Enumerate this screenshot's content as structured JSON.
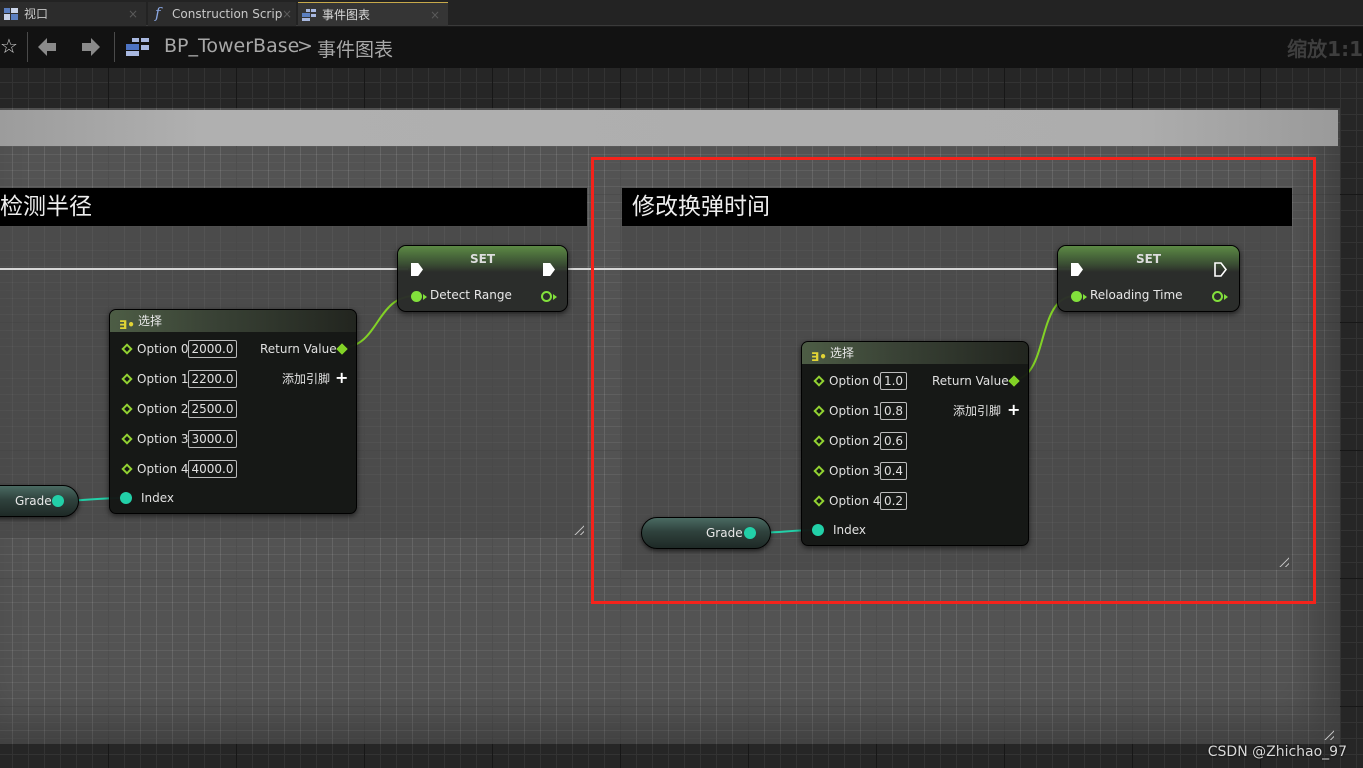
{
  "tabs": [
    {
      "label": "视口",
      "icon": "viewport-icon",
      "close": "×"
    },
    {
      "label": "Construction Scrip",
      "icon": "function-icon",
      "close": "×"
    },
    {
      "label": "事件图表",
      "icon": "event-graph-icon",
      "close": "×",
      "active": true
    }
  ],
  "toolbar": {
    "favorite_icon": "☆",
    "back_icon": "🡄",
    "forward_icon": "🡆",
    "breadcrumb": [
      "BP_TowerBase",
      "事件图表"
    ],
    "breadcrumb_separator": ">",
    "zoom_label": "缩放1:1"
  },
  "comments": {
    "left": {
      "title": "检测半径"
    },
    "right": {
      "title": "修改换弹时间"
    }
  },
  "left_group": {
    "select_node": {
      "title": "选择",
      "options": [
        {
          "label": "Option 0",
          "value": "2000.0"
        },
        {
          "label": "Option 1",
          "value": "2200.0"
        },
        {
          "label": "Option 2",
          "value": "2500.0"
        },
        {
          "label": "Option 3",
          "value": "3000.0"
        },
        {
          "label": "Option 4",
          "value": "4000.0"
        }
      ],
      "return_label": "Return Value",
      "add_pin_label": "添加引脚",
      "add_pin_icon": "+",
      "index_label": "Index"
    },
    "set_node": {
      "title": "SET",
      "variable": "Detect Range"
    },
    "get_node": {
      "label": "Grade"
    }
  },
  "right_group": {
    "select_node": {
      "title": "选择",
      "options": [
        {
          "label": "Option 0",
          "value": "1.0"
        },
        {
          "label": "Option 1",
          "value": "0.8"
        },
        {
          "label": "Option 2",
          "value": "0.6"
        },
        {
          "label": "Option 3",
          "value": "0.4"
        },
        {
          "label": "Option 4",
          "value": "0.2"
        }
      ],
      "return_label": "Return Value",
      "add_pin_label": "添加引脚",
      "add_pin_icon": "+",
      "index_label": "Index"
    },
    "set_node": {
      "title": "SET",
      "variable": "Reloading Time"
    },
    "get_node": {
      "label": "Grade"
    }
  },
  "colors": {
    "highlight_box": "#f4231b",
    "float_pin": "#82e03c",
    "int_pin": "#22d0a8",
    "select_icon": "#e2d435"
  },
  "watermark": "CSDN @Zhichao_97"
}
